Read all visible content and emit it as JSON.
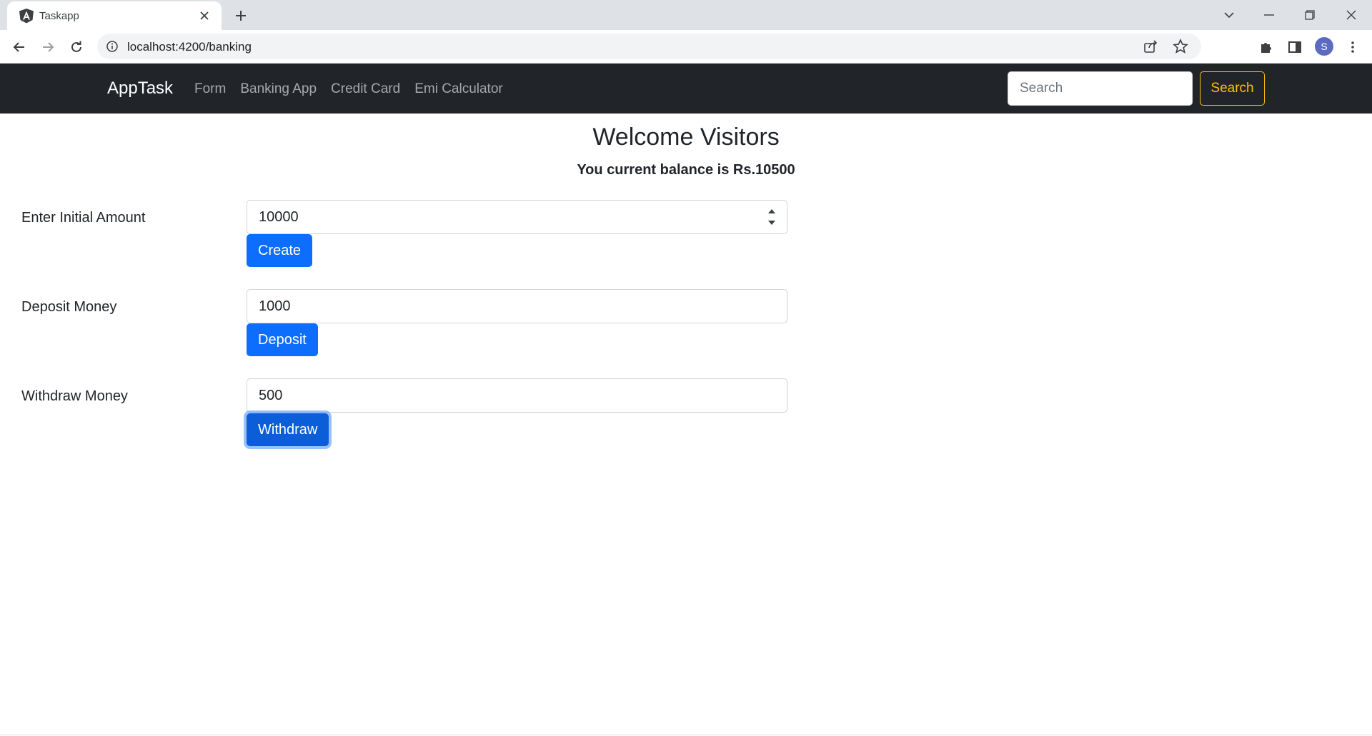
{
  "browser": {
    "tab_title": "Taskapp",
    "url": "localhost:4200/banking",
    "profile_initial": "S",
    "icons": {
      "favicon": "angular-logo-icon",
      "tab_close": "close-icon",
      "new_tab": "plus-icon",
      "tab_search": "chevron-down-icon",
      "minimize": "minimize-icon",
      "restore": "restore-icon",
      "close": "close-icon",
      "back": "arrow-left-icon",
      "forward": "arrow-right-icon",
      "reload": "reload-icon",
      "site_info": "info-icon",
      "share": "share-icon",
      "bookmark": "star-icon",
      "extensions": "puzzle-icon",
      "side_panel": "side-panel-icon",
      "menu": "kebab-menu-icon"
    }
  },
  "navbar": {
    "brand": "AppTask",
    "links": [
      "Form",
      "Banking App",
      "Credit Card",
      "Emi Calculator"
    ],
    "search_placeholder": "Search",
    "search_button": "Search",
    "colors": {
      "background": "#212529",
      "search_button": "#ffc107"
    }
  },
  "main": {
    "title": "Welcome Visitors",
    "balance_text": "You current balance is Rs.10500",
    "forms": [
      {
        "label": "Enter Initial Amount",
        "value": "10000",
        "button": "Create"
      },
      {
        "label": "Deposit Money",
        "value": "1000",
        "button": "Deposit"
      },
      {
        "label": "Withdraw Money",
        "value": "500",
        "button": "Withdraw"
      }
    ],
    "colors": {
      "primary": "#0d6efd"
    }
  }
}
